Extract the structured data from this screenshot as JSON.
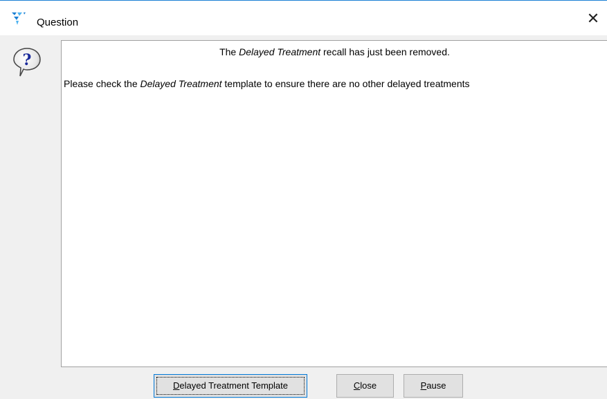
{
  "window": {
    "title": "Question",
    "close_glyph": "✕",
    "app_icon": "funnel-logo-icon",
    "message_icon": "question-icon"
  },
  "message": {
    "line1_prefix": "The ",
    "line1_emphasis": "Delayed Treatment",
    "line1_suffix": " recall has just been removed.",
    "line2_prefix": "Please check the ",
    "line2_emphasis": "Delayed Treatment",
    "line2_suffix": " template to ensure there are no other delayed treatments"
  },
  "buttons": {
    "template_label": "Delayed Treatment Template",
    "close_label": "Close",
    "pause_label": "Pause"
  },
  "colors": {
    "accent": "#0078d7",
    "icon_blue": "#1a7fd4"
  }
}
